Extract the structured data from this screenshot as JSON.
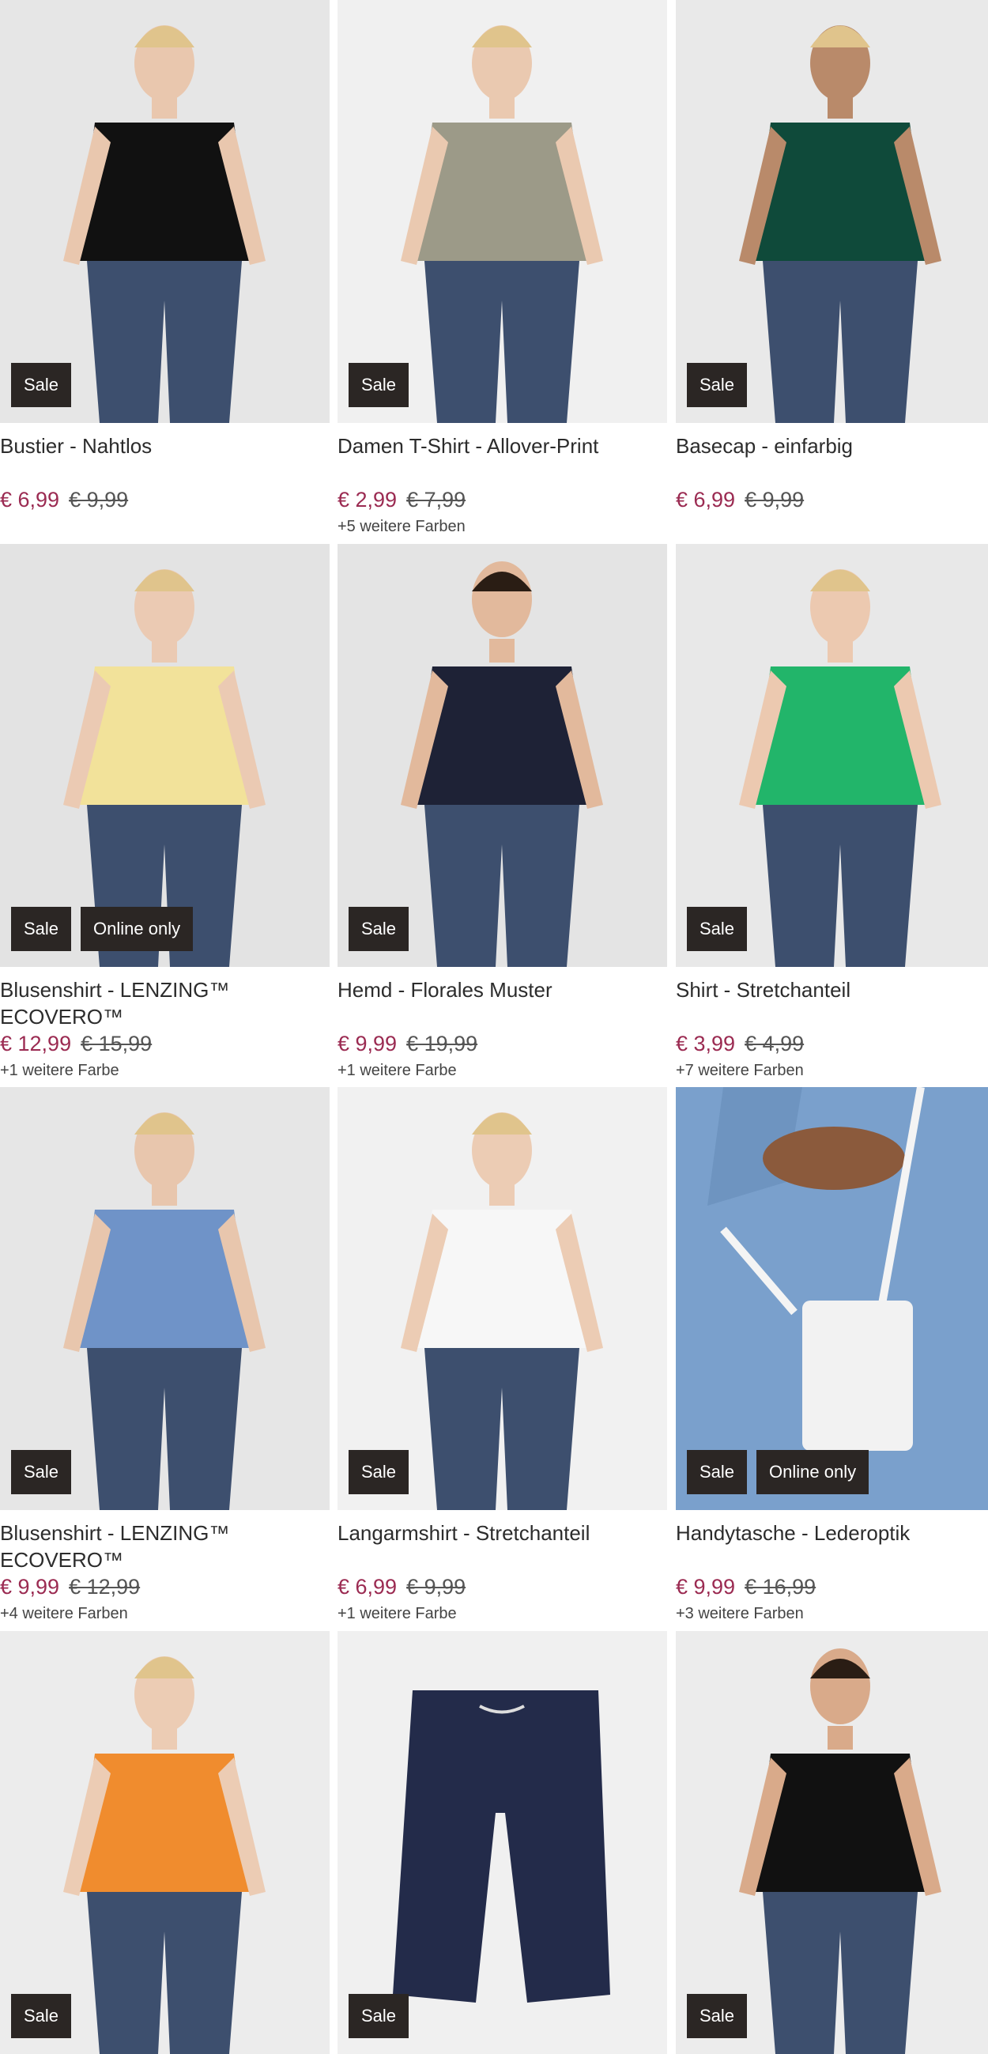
{
  "products": [
    {
      "title": "Bustier - Nahtlos",
      "price_now": "€ 6,99",
      "price_old": "€ 9,99",
      "colors": "",
      "badges": [
        "Sale"
      ],
      "image": "woman-black-bustier",
      "bg": "#e6e6e6",
      "fg": "#111111",
      "skin": "#e9c7ae"
    },
    {
      "title": "Damen T-Shirt - Allover-Print",
      "price_now": "€ 2,99",
      "price_old": "€ 7,99",
      "colors": "+5 weitere Farben",
      "badges": [
        "Sale"
      ],
      "image": "woman-printed-tshirt-jeans",
      "bg": "#f0f0f0",
      "fg": "#9c9a88",
      "skin": "#eac9b0"
    },
    {
      "title": "Basecap - einfarbig",
      "price_now": "€ 6,99",
      "price_old": "€ 9,99",
      "colors": "",
      "badges": [
        "Sale"
      ],
      "image": "woman-green-vest-cap",
      "bg": "#e9e9e9",
      "fg": "#0f4a3a",
      "skin": "#b98a6a"
    },
    {
      "title": "Blusenshirt - LENZING™ ECOVERO™",
      "price_now": "€ 12,99",
      "price_old": "€ 15,99",
      "colors": "+1 weitere Farbe",
      "badges": [
        "Sale",
        "Online only"
      ],
      "image": "woman-yellow-blouse",
      "bg": "#e3e3e3",
      "fg": "#f2e29a",
      "skin": "#ebcab3"
    },
    {
      "title": "Hemd - Florales Muster",
      "price_now": "€ 9,99",
      "price_old": "€ 19,99",
      "colors": "+1 weitere Farbe",
      "badges": [
        "Sale"
      ],
      "image": "man-floral-shirt",
      "bg": "#e4e4e4",
      "fg": "#1e2236",
      "skin": "#e2b99c"
    },
    {
      "title": "Shirt - Stretchanteil",
      "price_now": "€ 3,99",
      "price_old": "€ 4,99",
      "colors": "+7 weitere Farben",
      "badges": [
        "Sale"
      ],
      "image": "woman-green-shirt",
      "bg": "#e8e8e8",
      "fg": "#22b56a",
      "skin": "#ecc9b0"
    },
    {
      "title": "Blusenshirt - LENZING™ ECOVERO™",
      "price_now": "€ 9,99",
      "price_old": "€ 12,99",
      "colors": "+4 weitere Farben",
      "badges": [
        "Sale"
      ],
      "image": "woman-striped-blouse-seated",
      "bg": "#e6e6e6",
      "fg": "#6f93c8",
      "skin": "#e8c6ad"
    },
    {
      "title": "Langarmshirt - Stretchanteil",
      "price_now": "€ 6,99",
      "price_old": "€ 9,99",
      "colors": "+1 weitere Farbe",
      "badges": [
        "Sale"
      ],
      "image": "woman-white-longsleeve",
      "bg": "#f1f1f1",
      "fg": "#f7f7f7",
      "skin": "#ecccb4"
    },
    {
      "title": "Handytasche - Lederoptik",
      "price_now": "€ 9,99",
      "price_old": "€ 16,99",
      "colors": "+3 weitere Farben",
      "badges": [
        "Sale",
        "Online only"
      ],
      "image": "white-phone-bag",
      "bg": "#7ea3cf",
      "fg": "#f2f2f2",
      "skin": "#8b5a3c"
    },
    {
      "title": "",
      "price_now": "",
      "price_old": "",
      "colors": "",
      "badges": [
        "Sale"
      ],
      "image": "woman-orange-leggings",
      "bg": "#ececec",
      "fg": "#f08c2e",
      "skin": "#ecccb4"
    },
    {
      "title": "",
      "price_now": "",
      "price_old": "",
      "colors": "",
      "badges": [
        "Sale"
      ],
      "image": "navy-shorts",
      "bg": "#f0f0f0",
      "fg": "#232b4a",
      "skin": "#f0f0f0"
    },
    {
      "title": "",
      "price_now": "",
      "price_old": "",
      "colors": "",
      "badges": [
        "Sale"
      ],
      "image": "man-black-tshirt",
      "bg": "#ececec",
      "fg": "#111111",
      "skin": "#d9aa8a"
    }
  ]
}
